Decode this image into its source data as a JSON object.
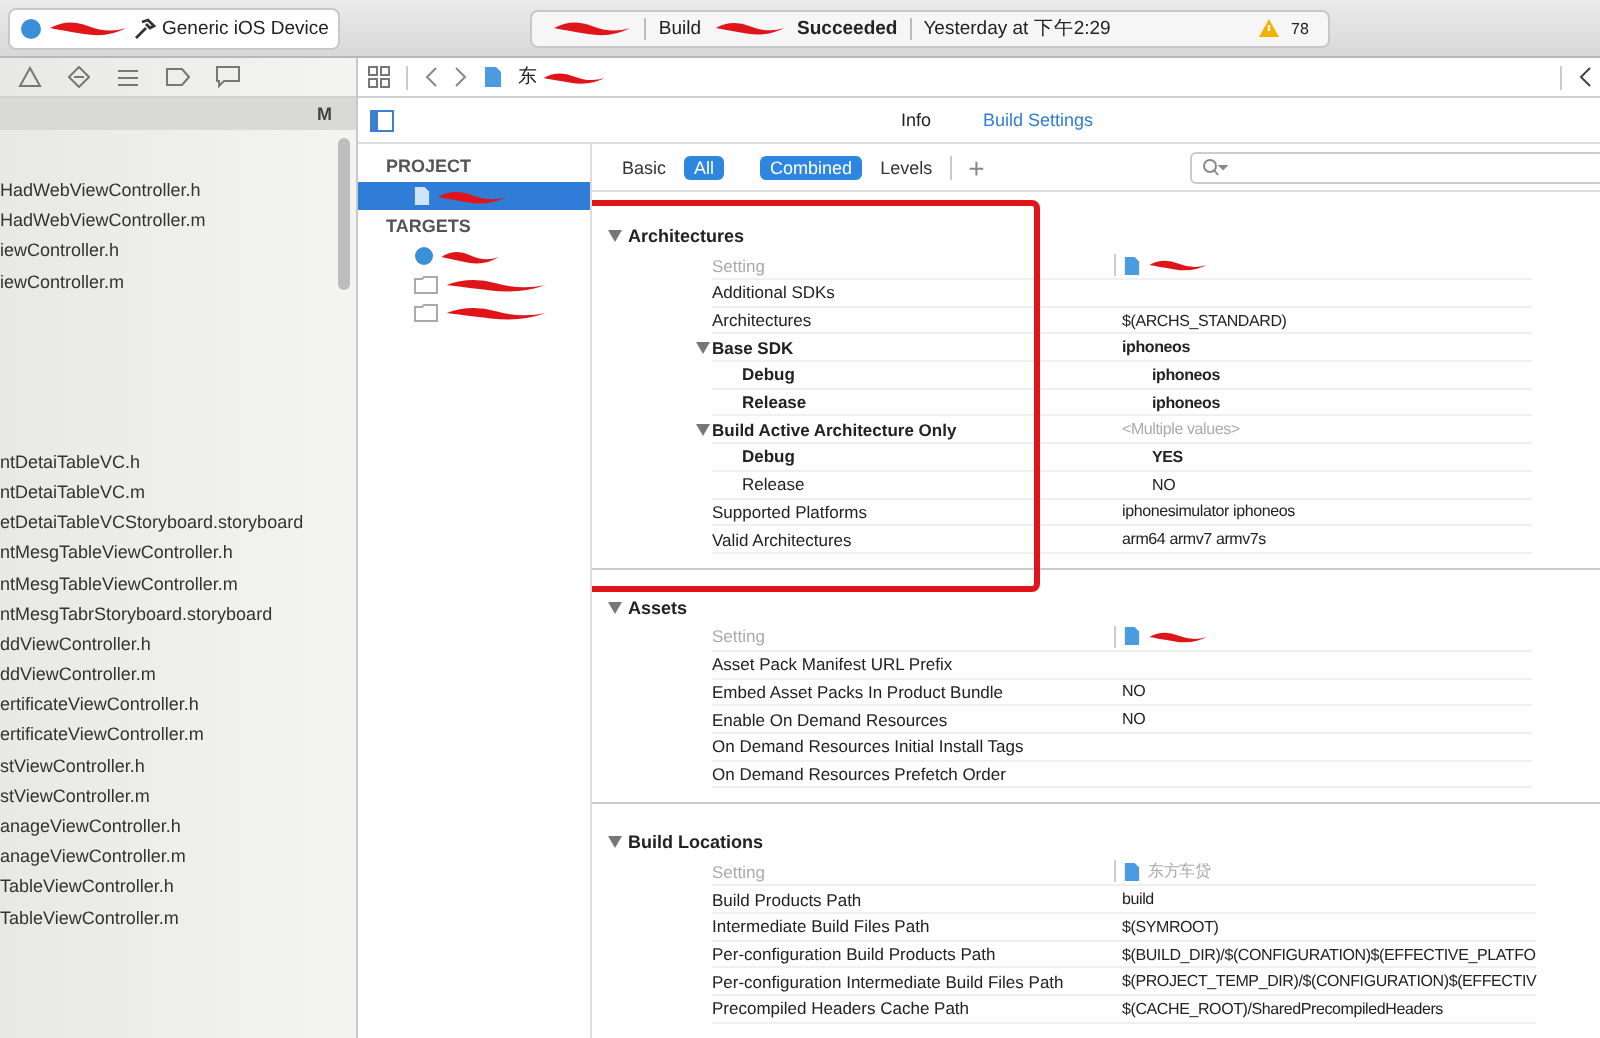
{
  "toolbar": {
    "device": "Generic iOS Device",
    "status_prefix": "Build",
    "status_result": "Succeeded",
    "status_time": "Yesterday at 下午2:29",
    "warnings": "78"
  },
  "navigator": {
    "badge": "M",
    "files_upper": [
      "HadWebViewController.h",
      "HadWebViewController.m",
      "iewController.h",
      "iewController.m"
    ],
    "files_lower": [
      "ntDetaiTableVC.h",
      "ntDetaiTableVC.m",
      "etDetaiTableVCStoryboard.storyboard",
      "ntMesgTableViewController.h",
      "ntMesgTableViewController.m",
      "ntMesgTabrStoryboard.storyboard",
      "ddViewController.h",
      "ddViewController.m",
      "ertificateViewController.h",
      "ertificateViewController.m",
      "stViewController.h",
      "stViewController.m",
      "anageViewController.h",
      "anageViewController.m",
      "TableViewController.h",
      "TableViewController.m"
    ]
  },
  "jump_bar": {
    "crumb": "东"
  },
  "editor_tabs": [
    {
      "label": "Info",
      "selected": false
    },
    {
      "label": "Build Settings",
      "selected": true
    }
  ],
  "project_list": {
    "project_header": "PROJECT",
    "project_selected": true,
    "targets_header": "TARGETS",
    "targets": [
      {
        "kind": "app",
        "selected": false
      },
      {
        "kind": "bundle",
        "selected": false
      },
      {
        "kind": "bundle",
        "selected": false
      }
    ]
  },
  "filter_bar": {
    "scopes": [
      {
        "label": "Basic",
        "selected": false
      },
      {
        "label": "All",
        "selected": true
      }
    ],
    "views": [
      {
        "label": "Combined",
        "selected": true
      },
      {
        "label": "Levels",
        "selected": false
      }
    ],
    "add": "+"
  },
  "sections": [
    {
      "title": "Architectures",
      "expanded": true,
      "setting_header": "Setting",
      "rows": [
        {
          "name": "Additional SDKs",
          "value": "",
          "customized": false
        },
        {
          "name": "Architectures",
          "value": "$(ARCHS_STANDARD)",
          "customized": false,
          "muted": false
        },
        {
          "name": "Base SDK",
          "value": "iphoneos",
          "customized": true,
          "muted": false,
          "expanded": true,
          "children": [
            {
              "name": "Debug",
              "value": "iphoneos",
              "customized": true,
              "muted": false
            },
            {
              "name": "Release",
              "value": "iphoneos",
              "customized": true,
              "muted": false
            }
          ]
        },
        {
          "name": "Build Active Architecture Only",
          "value": "<Multiple values>",
          "customized": true,
          "muted": true,
          "expanded": true,
          "children": [
            {
              "name": "Debug",
              "value": "YES",
              "customized": true,
              "muted": false
            },
            {
              "name": "Release",
              "value": "NO",
              "customized": false,
              "muted": false
            }
          ]
        },
        {
          "name": "Supported Platforms",
          "value": "iphonesimulator iphoneos",
          "customized": false,
          "muted": false
        },
        {
          "name": "Valid Architectures",
          "value": "arm64 armv7 armv7s",
          "customized": false,
          "muted": false
        }
      ]
    },
    {
      "title": "Assets",
      "expanded": true,
      "setting_header": "Setting",
      "rows": [
        {
          "name": "Asset Pack Manifest URL Prefix",
          "value": "",
          "customized": false
        },
        {
          "name": "Embed Asset Packs In Product Bundle",
          "value": "NO",
          "customized": false,
          "muted": false
        },
        {
          "name": "Enable On Demand Resources",
          "value": "NO",
          "customized": false,
          "muted": false
        },
        {
          "name": "On Demand Resources Initial Install Tags",
          "value": "",
          "customized": false
        },
        {
          "name": "On Demand Resources Prefetch Order",
          "value": "",
          "customized": false
        }
      ]
    },
    {
      "title": "Build Locations",
      "expanded": true,
      "setting_header": "Setting",
      "target_label": "东方车贷",
      "rows": [
        {
          "name": "Build Products Path",
          "value": "build",
          "customized": false,
          "muted": false
        },
        {
          "name": "Intermediate Build Files Path",
          "value": "$(SYMROOT)",
          "customized": false,
          "muted": false
        },
        {
          "name": "Per-configuration Build Products Path",
          "value": "$(BUILD_DIR)/$(CONFIGURATION)$(EFFECTIVE_PLATFO",
          "customized": false,
          "muted": false
        },
        {
          "name": "Per-configuration Intermediate Build Files Path",
          "value": "$(PROJECT_TEMP_DIR)/$(CONFIGURATION)$(EFFECTIV",
          "customized": false,
          "muted": false
        },
        {
          "name": "Precompiled Headers Cache Path",
          "value": "$(CACHE_ROOT)/SharedPrecompiledHeaders",
          "customized": false,
          "muted": false
        }
      ]
    }
  ]
}
